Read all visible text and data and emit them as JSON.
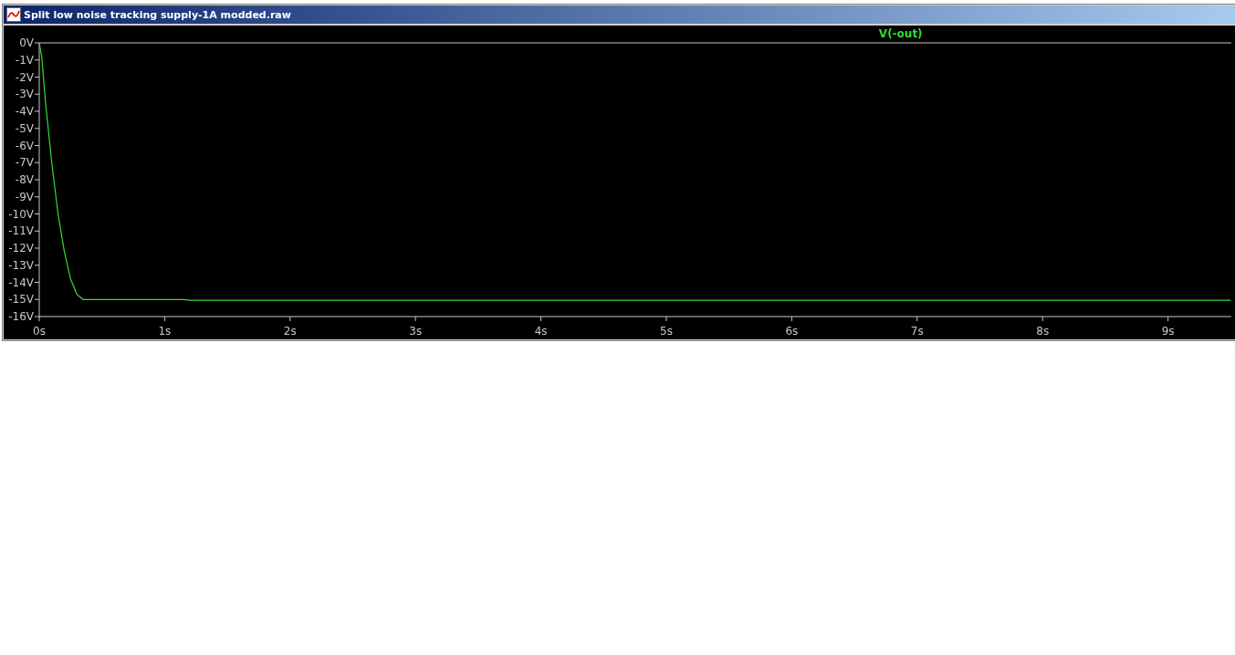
{
  "window": {
    "title": "Split low noise tracking supply-1A modded.raw"
  },
  "plot": {
    "chart_data": {
      "type": "line",
      "x": [
        0,
        0.02,
        0.05,
        0.1,
        0.15,
        0.2,
        0.25,
        0.3,
        0.35,
        0.4,
        1.15,
        1.2,
        9.5
      ],
      "series": [
        {
          "name": "V(-out)",
          "color": "#33dd33",
          "values": [
            0,
            -0.8,
            -3.5,
            -7,
            -10,
            -12.2,
            -13.8,
            -14.7,
            -15,
            -15,
            -15,
            -15.05,
            -15.05
          ]
        }
      ],
      "xlim": [
        0,
        9.5
      ],
      "ylim": [
        -16,
        0
      ],
      "xticks": [
        {
          "value": 0,
          "label": "0s"
        },
        {
          "value": 1,
          "label": "1s"
        },
        {
          "value": 2,
          "label": "2s"
        },
        {
          "value": 3,
          "label": "3s"
        },
        {
          "value": 4,
          "label": "4s"
        },
        {
          "value": 5,
          "label": "5s"
        },
        {
          "value": 6,
          "label": "6s"
        },
        {
          "value": 7,
          "label": "7s"
        },
        {
          "value": 8,
          "label": "8s"
        },
        {
          "value": 9,
          "label": "9s"
        }
      ],
      "yticks": [
        {
          "value": 0,
          "label": "0V"
        },
        {
          "value": -1,
          "label": "-1V"
        },
        {
          "value": -2,
          "label": "-2V"
        },
        {
          "value": -3,
          "label": "-3V"
        },
        {
          "value": -4,
          "label": "-4V"
        },
        {
          "value": -5,
          "label": "-5V"
        },
        {
          "value": -6,
          "label": "-6V"
        },
        {
          "value": -7,
          "label": "-7V"
        },
        {
          "value": -8,
          "label": "-8V"
        },
        {
          "value": -9,
          "label": "-9V"
        },
        {
          "value": -10,
          "label": "-10V"
        },
        {
          "value": -11,
          "label": "-11V"
        },
        {
          "value": -12,
          "label": "-12V"
        },
        {
          "value": -13,
          "label": "-13V"
        },
        {
          "value": -14,
          "label": "-14V"
        },
        {
          "value": -15,
          "label": "-15V"
        },
        {
          "value": -16,
          "label": "-16V"
        }
      ]
    }
  }
}
